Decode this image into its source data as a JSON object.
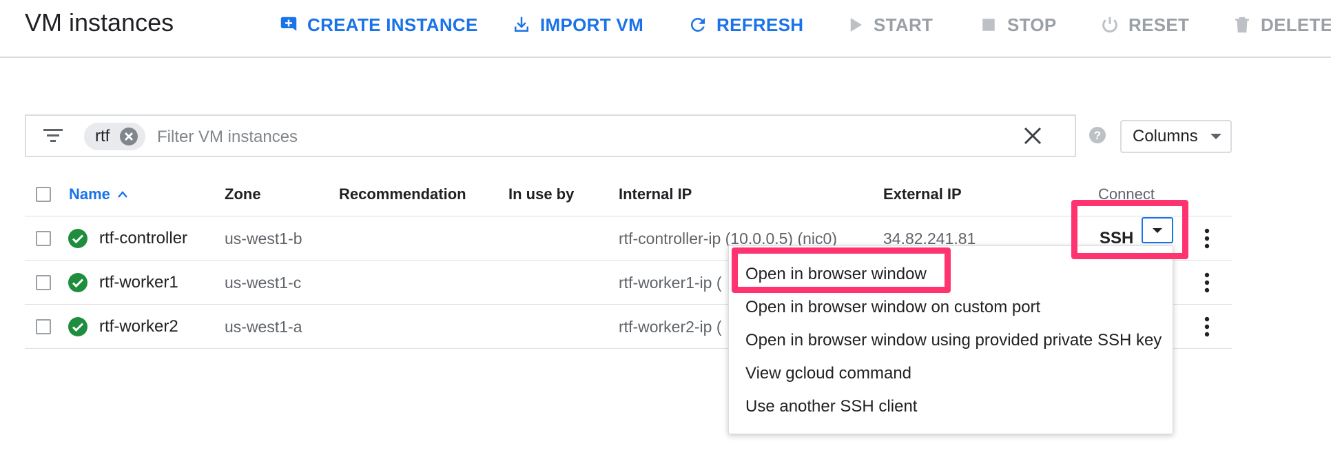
{
  "page_title": "VM instances",
  "toolbar": {
    "create_instance": "CREATE INSTANCE",
    "import_vm": "IMPORT VM",
    "refresh": "REFRESH",
    "start": "START",
    "stop": "STOP",
    "reset": "RESET",
    "delete": "DELETE"
  },
  "filter": {
    "chip_label": "rtf",
    "placeholder": "Filter VM instances",
    "columns_label": "Columns"
  },
  "table": {
    "headers": {
      "name": "Name",
      "zone": "Zone",
      "recommendation": "Recommendation",
      "in_use_by": "In use by",
      "internal_ip": "Internal IP",
      "external_ip": "External IP",
      "connect": "Connect"
    },
    "rows": [
      {
        "name": "rtf-controller",
        "zone": "us-west1-b",
        "internal_ip": "rtf-controller-ip (10.0.0.5) (nic0)",
        "external_ip": "34.82.241.81",
        "status": "running"
      },
      {
        "name": "rtf-worker1",
        "zone": "us-west1-c",
        "internal_ip": "rtf-worker1-ip (",
        "external_ip": "",
        "status": "running"
      },
      {
        "name": "rtf-worker2",
        "zone": "us-west1-a",
        "internal_ip": "rtf-worker2-ip (",
        "external_ip": "",
        "status": "running"
      }
    ]
  },
  "connect": {
    "ssh_label": "SSH",
    "menu_items": [
      "Open in browser window",
      "Open in browser window on custom port",
      "Open in browser window using provided private SSH key",
      "View gcloud command",
      "Use another SSH client"
    ]
  },
  "colors": {
    "accent": "#1a73e8",
    "disabled": "#9aa0a6",
    "status_ok": "#1e8e3e",
    "highlight": "#ff3370"
  }
}
